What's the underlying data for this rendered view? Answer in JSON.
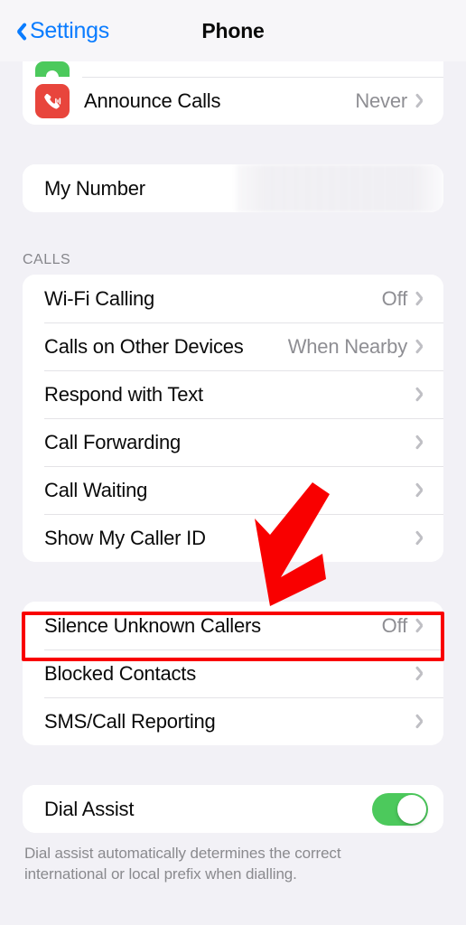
{
  "nav": {
    "back_label": "Settings",
    "title": "Phone",
    "back_icon": "chevron-left-icon",
    "accent_color": "#0A7CFF"
  },
  "groups": {
    "top": {
      "clipped_row": {
        "label": "",
        "icon": "announce-notifications-green-icon",
        "icon_color": "#4CC95C"
      },
      "rows": [
        {
          "label": "Announce Calls",
          "value": "Never",
          "icon": "announce-calls-phone-icon",
          "icon_color": "#E8453C",
          "accessory": "chevron-right-icon"
        }
      ]
    },
    "my_number": {
      "rows": [
        {
          "label": "My Number",
          "value": "",
          "redacted": true,
          "accessory": "none"
        }
      ]
    },
    "calls": {
      "header": "CALLS",
      "rows": [
        {
          "label": "Wi-Fi Calling",
          "value": "Off",
          "accessory": "chevron-right-icon"
        },
        {
          "label": "Calls on Other Devices",
          "value": "When Nearby",
          "accessory": "chevron-right-icon"
        },
        {
          "label": "Respond with Text",
          "value": "",
          "accessory": "chevron-right-icon"
        },
        {
          "label": "Call Forwarding",
          "value": "",
          "accessory": "chevron-right-icon"
        },
        {
          "label": "Call Waiting",
          "value": "",
          "accessory": "chevron-right-icon"
        },
        {
          "label": "Show My Caller ID",
          "value": "",
          "accessory": "chevron-right-icon"
        }
      ]
    },
    "silence": {
      "rows": [
        {
          "label": "Silence Unknown Callers",
          "value": "Off",
          "accessory": "chevron-right-icon",
          "highlighted": true
        },
        {
          "label": "Blocked Contacts",
          "value": "",
          "accessory": "chevron-right-icon"
        },
        {
          "label": "SMS/Call Reporting",
          "value": "",
          "accessory": "chevron-right-icon"
        }
      ]
    },
    "dial_assist": {
      "rows": [
        {
          "label": "Dial Assist",
          "toggle": true,
          "toggle_on": true,
          "toggle_color": "#4CC95C"
        }
      ],
      "footer": "Dial assist automatically determines the correct international or local prefix when dialling."
    }
  },
  "annotations": {
    "highlight_color": "#F90000",
    "arrow_color": "#F90000",
    "arrow_direction": "down-left",
    "highlight_target": "Silence Unknown Callers"
  },
  "theme": {
    "background": "#F2F1F6",
    "card": "#FFFFFF",
    "separator": "#E4E3E7",
    "primary_text": "#0A0A0A",
    "secondary_text": "#8E8E93",
    "chevron": "#BFBFC4"
  }
}
